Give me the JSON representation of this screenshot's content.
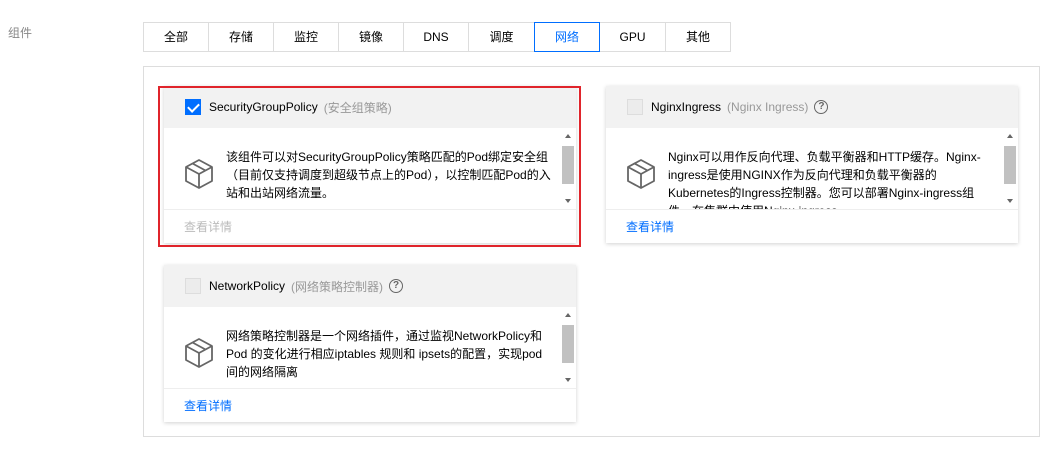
{
  "field": {
    "label": "组件"
  },
  "tabs": [
    {
      "label": "全部",
      "active": false
    },
    {
      "label": "存储",
      "active": false
    },
    {
      "label": "监控",
      "active": false
    },
    {
      "label": "镜像",
      "active": false
    },
    {
      "label": "DNS",
      "active": false
    },
    {
      "label": "调度",
      "active": false
    },
    {
      "label": "网络",
      "active": true
    },
    {
      "label": "GPU",
      "active": false
    },
    {
      "label": "其他",
      "active": false
    }
  ],
  "cards": [
    {
      "title": "SecurityGroupPolicy",
      "subtitle": "(安全组策略)",
      "checked": true,
      "description": "该组件可以对SecurityGroupPolicy策略匹配的Pod绑定安全组（目前仅支持调度到超级节点上的Pod），以控制匹配Pod的入站和出站网络流量。",
      "link": "查看详情",
      "link_disabled": true,
      "icon": "package-cube-icon"
    },
    {
      "title": "NginxIngress",
      "subtitle": "(Nginx Ingress)",
      "checked": false,
      "description": "Nginx可以用作反向代理、负载平衡器和HTTP缓存。Nginx-ingress是使用NGINX作为反向代理和负载平衡器的Kubernetes的Ingress控制器。您可以部署Nginx-ingress组件，在集群中使用Nginx-ingress",
      "link": "查看详情",
      "link_disabled": false,
      "icon": "package-cube-icon"
    },
    {
      "title": "NetworkPolicy",
      "subtitle": "(网络策略控制器)",
      "checked": false,
      "description": "网络策略控制器是一个网络插件，通过监视NetworkPolicy和Pod 的变化进行相应iptables 规则和 ipsets的配置，实现pod间的网络隔离",
      "link": "查看详情",
      "link_disabled": false,
      "icon": "package-cube-icon"
    }
  ],
  "colors": {
    "accent": "#006eff",
    "highlight": "#e0242b"
  }
}
